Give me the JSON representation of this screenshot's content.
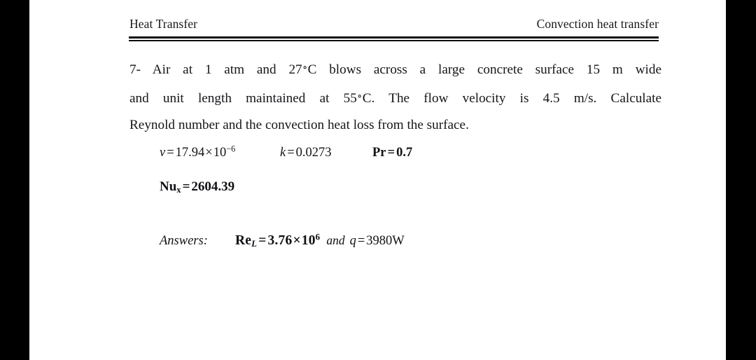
{
  "page": {
    "background_color": "#ffffff",
    "margin_color": "#000000"
  },
  "header": {
    "left_title": "Heat Transfer",
    "right_title": "Convection heat transfer",
    "rule": "double-rule"
  },
  "problem": {
    "number": "7-",
    "line1": "7- Air at 1 atm and 27∘C blows across a large concrete surface 15 m wide",
    "line2": "and unit length maintained at 55∘C. The flow velocity is 4.5 m/s. Calculate",
    "line3": "Reynold number and the convection heat loss from the surface.",
    "line1_parts": {
      "a": "7- Air at 1 atm and 27",
      "degree": "∘",
      "b": "C blows across a large concrete surface 15 m wide"
    },
    "line2_parts": {
      "a": "and unit length maintained at 55",
      "degree": "∘",
      "b": "C. The flow velocity is 4.5 m/s. Calculate"
    }
  },
  "given": {
    "nu": {
      "symbol": "v",
      "equals": "=",
      "value": "17.94",
      "times": "×",
      "base": "10",
      "exponent": "−6"
    },
    "k": {
      "symbol": "k",
      "equals": "=",
      "value": "0.0273"
    },
    "pr": {
      "symbol": "Pr",
      "equals": "=",
      "value": "0.7"
    },
    "nusselt": {
      "symbol": "Nu",
      "subscript": "x",
      "equals": "=",
      "value": "2604.39"
    }
  },
  "answers": {
    "label": "Answers:",
    "reynolds": {
      "symbol": "Re",
      "subscript": "L",
      "equals": "=",
      "value": "3.76",
      "times": "×",
      "base": "10",
      "exponent": "6"
    },
    "conjunction": "and",
    "heat": {
      "symbol": "q",
      "equals": "=",
      "value": "3980W"
    }
  }
}
